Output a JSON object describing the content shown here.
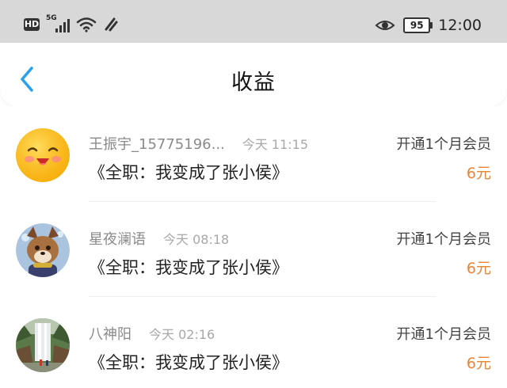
{
  "status_bar": {
    "hd": "HD",
    "network": "5G",
    "battery": "95",
    "time": "12:00",
    "icons": [
      "signal-icon",
      "wifi-icon",
      "nfc-icon",
      "eye-icon",
      "battery-icon"
    ]
  },
  "header": {
    "title": "收益",
    "back_icon": "chevron-left-icon",
    "accent_color": "#2aa0e8"
  },
  "records": [
    {
      "user": "王振宇_15775196...",
      "time": "今天 11:15",
      "book": "《全职：我变成了张小侯》",
      "action": "开通1个月会员",
      "amount": "6元",
      "avatar": "smiley-face-avatar"
    },
    {
      "user": "星夜澜语",
      "time": "今天 08:18",
      "book": "《全职：我变成了张小侯》",
      "action": "开通1个月会员",
      "amount": "6元",
      "avatar": "fox-character-avatar"
    },
    {
      "user": "八神阳",
      "time": "今天 02:16",
      "book": "《全职：我变成了张小侯》",
      "action": "开通1个月会员",
      "amount": "6元",
      "avatar": "waterfall-avatar"
    }
  ],
  "colors": {
    "amount": "#e8833a",
    "status_bar_bg": "#d8d8d8"
  }
}
